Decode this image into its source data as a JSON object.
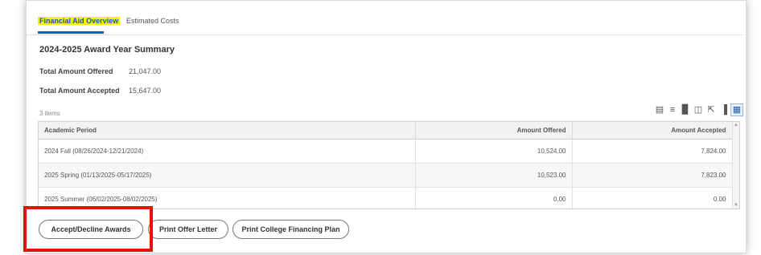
{
  "tabs": [
    {
      "label": "Financial Aid Overview",
      "active": true
    },
    {
      "label": "Estimated Costs",
      "active": false
    }
  ],
  "summary": {
    "title": "2024-2025 Award Year Summary",
    "total_offered_label": "Total Amount Offered",
    "total_offered_value": "21,047.00",
    "total_accepted_label": "Total Amount Accepted",
    "total_accepted_value": "15,647.00"
  },
  "table": {
    "items_count": "3 items",
    "columns": [
      "Academic Period",
      "Amount Offered",
      "Amount Accepted"
    ],
    "rows": [
      {
        "period": "2024 Fall (08/26/2024-12/21/2024)",
        "offered": "10,524.00",
        "accepted": "7,824.00"
      },
      {
        "period": "2025 Spring (01/13/2025-05/17/2025)",
        "offered": "10,523.00",
        "accepted": "7,823.00"
      },
      {
        "period": "2025 Summer (06/02/2025-08/02/2025)",
        "offered": "0.00",
        "accepted": "0.00"
      }
    ],
    "toolbar_icons": [
      "export-excel-icon",
      "filter-icon",
      "chart-icon",
      "column-settings-icon",
      "fullscreen-icon",
      "column-view-icon",
      "grid-view-icon"
    ]
  },
  "actions": {
    "accept_decline": "Accept/Decline Awards",
    "print_offer": "Print Offer Letter",
    "print_plan": "Print College Financing Plan"
  },
  "colors": {
    "tab_highlight": "#fff200",
    "tab_active_text": "#0b5ea8",
    "annotation_box": "#e8100c"
  }
}
